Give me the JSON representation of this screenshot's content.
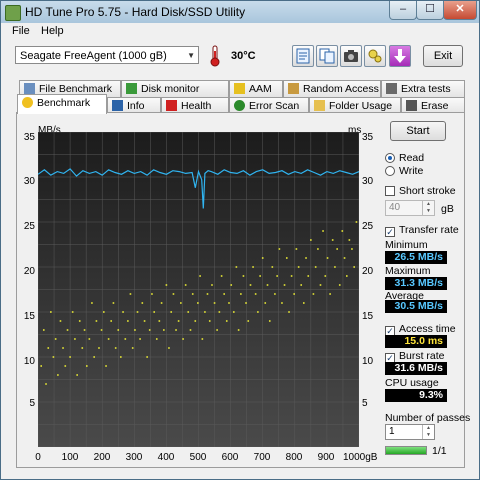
{
  "window": {
    "title": "HD Tune Pro 5.75 - Hard Disk/SSD Utility"
  },
  "window_buttons": {
    "minimize": "–",
    "maximize": "☐",
    "close": "✕"
  },
  "menu": [
    "File",
    "Help"
  ],
  "toolbar": {
    "drive": "Seagate FreeAgent (1000 gB)",
    "temperature": "30°C",
    "exit_label": "Exit",
    "icons": [
      "info-icon",
      "copy-icon",
      "screenshot-icon",
      "options-icon",
      "save-icon"
    ]
  },
  "tabs_top": [
    "File Benchmark",
    "Disk monitor",
    "AAM",
    "Random Access",
    "Extra tests"
  ],
  "tabs_bottom": [
    "Benchmark",
    "Info",
    "Health",
    "Error Scan",
    "Folder Usage",
    "Erase"
  ],
  "active_tab": "Benchmark",
  "side": {
    "start_label": "Start",
    "read_label": "Read",
    "write_label": "Write",
    "mode": "Read",
    "short_stroke_label": "Short stroke",
    "short_stroke_checked": false,
    "short_stroke_value": "40",
    "short_stroke_unit": "gB",
    "transfer_rate_label": "Transfer rate",
    "transfer_rate_checked": true,
    "minimum_label": "Minimum",
    "minimum_value": "26.5 MB/s",
    "maximum_label": "Maximum",
    "maximum_value": "31.3 MB/s",
    "average_label": "Average",
    "average_value": "30.5 MB/s",
    "access_time_label": "Access time",
    "access_time_checked": true,
    "access_time_value": "15.0 ms",
    "burst_rate_label": "Burst rate",
    "burst_rate_checked": true,
    "burst_rate_value": "31.6 MB/s",
    "cpu_usage_label": "CPU usage",
    "cpu_usage_value": "9.3%",
    "passes_label": "Number of passes",
    "passes_value": "1",
    "progress_text": "1/1",
    "progress_fraction": 1.0
  },
  "chart_data": {
    "type": "line",
    "ylabel_left": "MB/s",
    "ylabel_right": "ms",
    "xunit": "gB",
    "x_ticks": [
      "0",
      "100",
      "200",
      "300",
      "400",
      "500",
      "600",
      "700",
      "800",
      "900",
      "1000gB"
    ],
    "y_ticks_left": [
      "35",
      "30",
      "25",
      "20",
      "15",
      "10",
      "5"
    ],
    "y_ticks_right": [
      "35",
      "30",
      "25",
      "20",
      "15",
      "10",
      "5"
    ],
    "xlim": [
      0,
      1000
    ],
    "ylim": [
      0,
      35
    ],
    "grid": true,
    "colors": {
      "transfer": "#30b4f0",
      "access": "#e6e635",
      "grid": "#5a5a5a",
      "bg_top": "#1c1c1c",
      "bg_bottom": "#4a4a4a"
    },
    "series": [
      {
        "name": "Transfer rate",
        "axis": "left",
        "x": [
          0,
          20,
          40,
          60,
          80,
          100,
          120,
          140,
          160,
          180,
          200,
          220,
          240,
          260,
          280,
          300,
          320,
          340,
          360,
          380,
          400,
          420,
          440,
          460,
          480,
          490,
          500,
          510,
          515,
          520,
          530,
          540,
          560,
          580,
          600,
          620,
          640,
          660,
          680,
          700,
          720,
          740,
          760,
          780,
          800,
          820,
          840,
          860,
          880,
          900,
          920,
          940,
          960,
          980,
          1000
        ],
        "y": [
          30.3,
          30.8,
          30.2,
          30.6,
          30.4,
          30.9,
          30.1,
          30.7,
          30.4,
          30.6,
          30.2,
          30.8,
          30.5,
          30.3,
          30.7,
          30.4,
          30.6,
          30.2,
          30.8,
          30.5,
          30.3,
          30.7,
          30.6,
          30.4,
          30.5,
          28.8,
          30.6,
          29.7,
          26.5,
          30.4,
          30.7,
          30.6,
          30.3,
          30.8,
          30.5,
          30.4,
          30.7,
          30.2,
          30.6,
          30.8,
          30.4,
          30.5,
          30.7,
          30.3,
          30.6,
          30.4,
          30.8,
          30.5,
          30.2,
          30.6,
          30.4,
          30.7,
          30.5,
          30.3,
          30.6
        ]
      },
      {
        "name": "Access time",
        "axis": "right",
        "type": "scatter",
        "x": [
          10,
          18,
          25,
          32,
          40,
          48,
          55,
          62,
          70,
          78,
          85,
          92,
          100,
          108,
          115,
          122,
          130,
          138,
          145,
          152,
          160,
          168,
          175,
          182,
          190,
          198,
          205,
          212,
          220,
          228,
          235,
          242,
          250,
          258,
          265,
          272,
          280,
          288,
          295,
          302,
          310,
          318,
          325,
          332,
          340,
          348,
          355,
          362,
          370,
          378,
          385,
          392,
          400,
          408,
          415,
          422,
          430,
          438,
          445,
          452,
          460,
          468,
          475,
          482,
          490,
          498,
          505,
          512,
          520,
          528,
          535,
          542,
          550,
          558,
          565,
          572,
          580,
          588,
          595,
          602,
          610,
          618,
          625,
          632,
          640,
          648,
          655,
          662,
          670,
          678,
          685,
          692,
          700,
          708,
          715,
          722,
          730,
          738,
          745,
          752,
          760,
          768,
          775,
          782,
          790,
          798,
          805,
          812,
          820,
          828,
          835,
          842,
          850,
          858,
          865,
          872,
          880,
          888,
          895,
          902,
          910,
          918,
          925,
          932,
          940,
          948,
          955,
          962,
          970,
          978,
          985,
          992
        ],
        "y": [
          9,
          13,
          7,
          11,
          15,
          10,
          12,
          8,
          14,
          11,
          9,
          13,
          10,
          15,
          12,
          8,
          14,
          11,
          13,
          9,
          12,
          16,
          10,
          14,
          11,
          13,
          15,
          9,
          12,
          14,
          16,
          11,
          13,
          10,
          15,
          12,
          14,
          17,
          11,
          13,
          15,
          12,
          16,
          14,
          10,
          13,
          17,
          15,
          12,
          14,
          16,
          13,
          18,
          11,
          15,
          17,
          13,
          14,
          16,
          12,
          18,
          15,
          13,
          17,
          14,
          16,
          19,
          12,
          15,
          17,
          14,
          18,
          16,
          13,
          15,
          19,
          17,
          14,
          16,
          18,
          15,
          20,
          13,
          17,
          19,
          16,
          14,
          18,
          20,
          17,
          15,
          19,
          21,
          16,
          18,
          14,
          20,
          17,
          19,
          22,
          16,
          18,
          21,
          15,
          19,
          17,
          22,
          20,
          18,
          16,
          21,
          19,
          23,
          17,
          20,
          22,
          18,
          24,
          19,
          21,
          17,
          23,
          20,
          22,
          18,
          24,
          21,
          19,
          23,
          22,
          20,
          25
        ]
      }
    ]
  }
}
